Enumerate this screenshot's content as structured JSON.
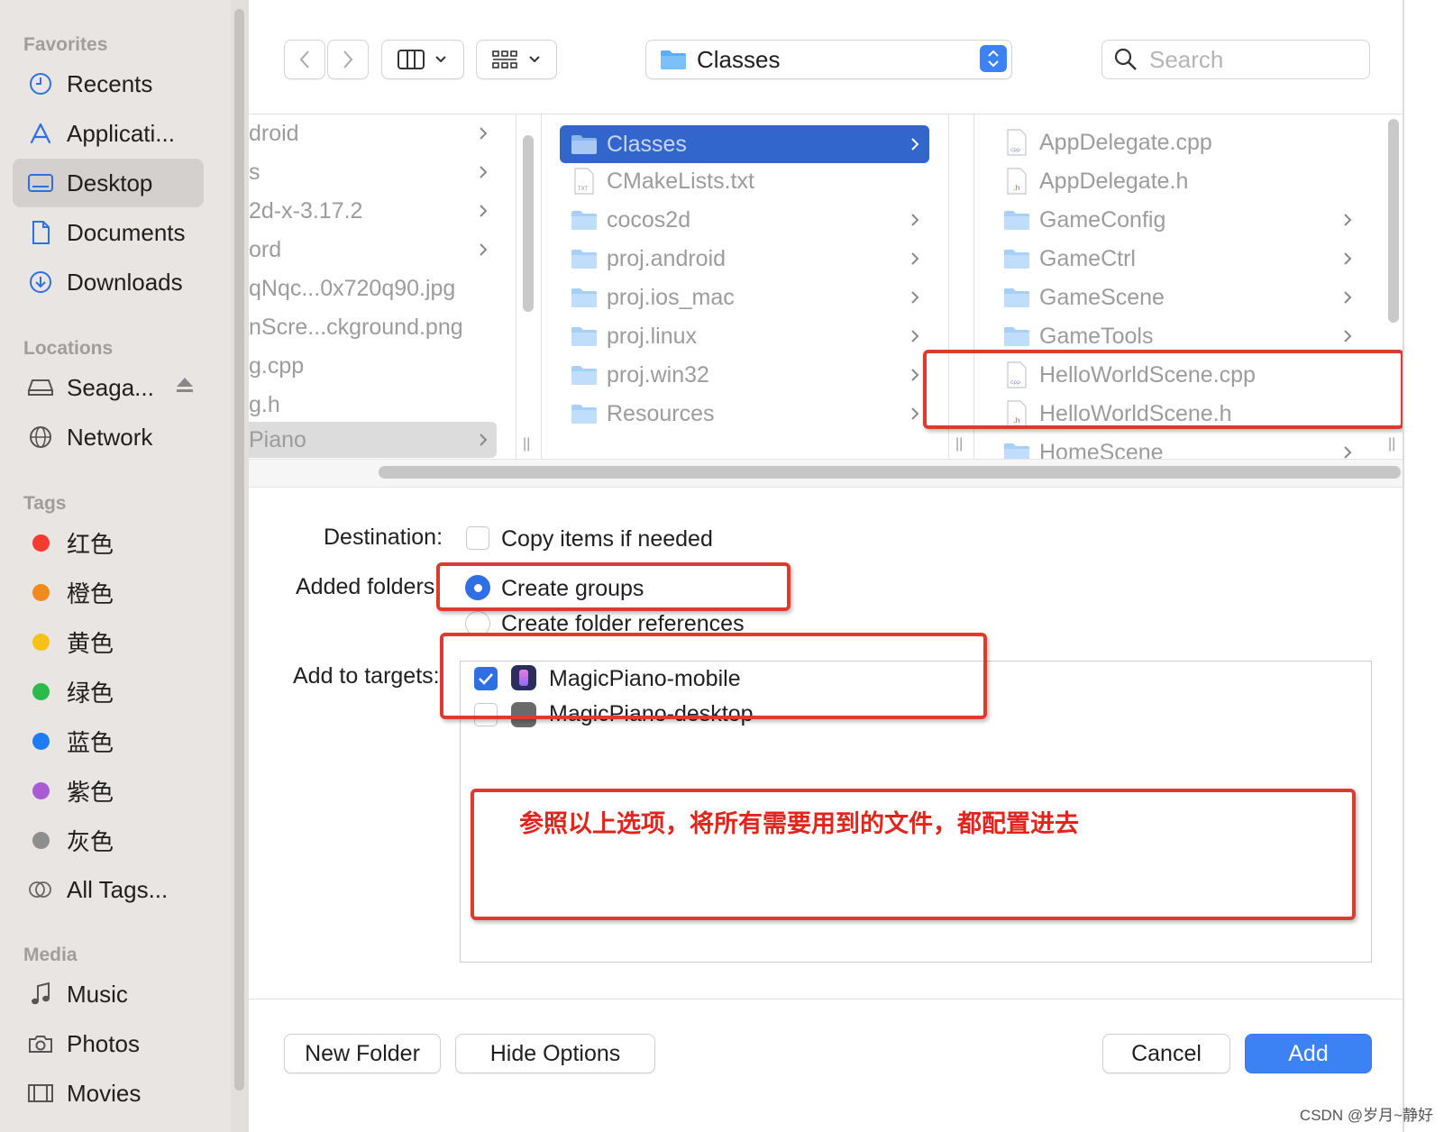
{
  "sidebar": {
    "favorites_title": "Favorites",
    "favorites": [
      {
        "label": "Recents",
        "icon": "clock-icon"
      },
      {
        "label": "Applicati...",
        "icon": "applications-icon"
      },
      {
        "label": "Desktop",
        "icon": "desktop-icon",
        "selected": true
      },
      {
        "label": "Documents",
        "icon": "document-icon"
      },
      {
        "label": "Downloads",
        "icon": "download-icon"
      }
    ],
    "locations_title": "Locations",
    "locations": [
      {
        "label": "Seaga...",
        "icon": "drive-icon"
      },
      {
        "label": "Network",
        "icon": "globe-icon"
      }
    ],
    "tags_title": "Tags",
    "tags": [
      {
        "label": "红色",
        "color": "#f33b30"
      },
      {
        "label": "橙色",
        "color": "#f08a1c"
      },
      {
        "label": "黄色",
        "color": "#f5c217"
      },
      {
        "label": "绿色",
        "color": "#2db94c"
      },
      {
        "label": "蓝色",
        "color": "#1d7cf2"
      },
      {
        "label": "紫色",
        "color": "#a95bd3"
      },
      {
        "label": "灰色",
        "color": "#8e8e8e"
      }
    ],
    "all_tags": "All Tags...",
    "media_title": "Media",
    "media": [
      {
        "label": "Music",
        "icon": "music-icon"
      },
      {
        "label": "Photos",
        "icon": "camera-icon"
      },
      {
        "label": "Movies",
        "icon": "film-icon"
      }
    ]
  },
  "toolbar": {
    "path": "Classes",
    "search_placeholder": "Search"
  },
  "browser": {
    "col1": [
      "droid",
      "s",
      "2d-x-3.17.2",
      "ord",
      "qNqc...0x720q90.jpg",
      "nScre...ckground.png",
      "g.cpp",
      "g.h",
      "Piano"
    ],
    "col2": [
      "Classes",
      "CMakeLists.txt",
      "cocos2d",
      "proj.android",
      "proj.ios_mac",
      "proj.linux",
      "proj.win32",
      "Resources"
    ],
    "col3": [
      "AppDelegate.cpp",
      "AppDelegate.h",
      "GameConfig",
      "GameCtrl",
      "GameScene",
      "GameTools",
      "HelloWorldScene.cpp",
      "HelloWorldScene.h",
      "HomeScene"
    ]
  },
  "options": {
    "destination_label": "Destination:",
    "copy_items": "Copy items if needed",
    "added_folders_label": "Added folders:",
    "create_groups": "Create groups",
    "create_folder_refs": "Create folder references",
    "add_to_targets_label": "Add to targets:",
    "target_mobile": "MagicPiano-mobile",
    "target_desktop": "MagicPiano-desktop"
  },
  "annotation_text": "参照以上选项，将所有需要用到的文件，都配置进去",
  "buttons": {
    "new_folder": "New Folder",
    "hide_options": "Hide Options",
    "cancel": "Cancel",
    "add": "Add"
  },
  "watermark": "CSDN @岁月~静好",
  "colors": {
    "accent": "#3d82f5",
    "annotation": "#df3a30"
  }
}
